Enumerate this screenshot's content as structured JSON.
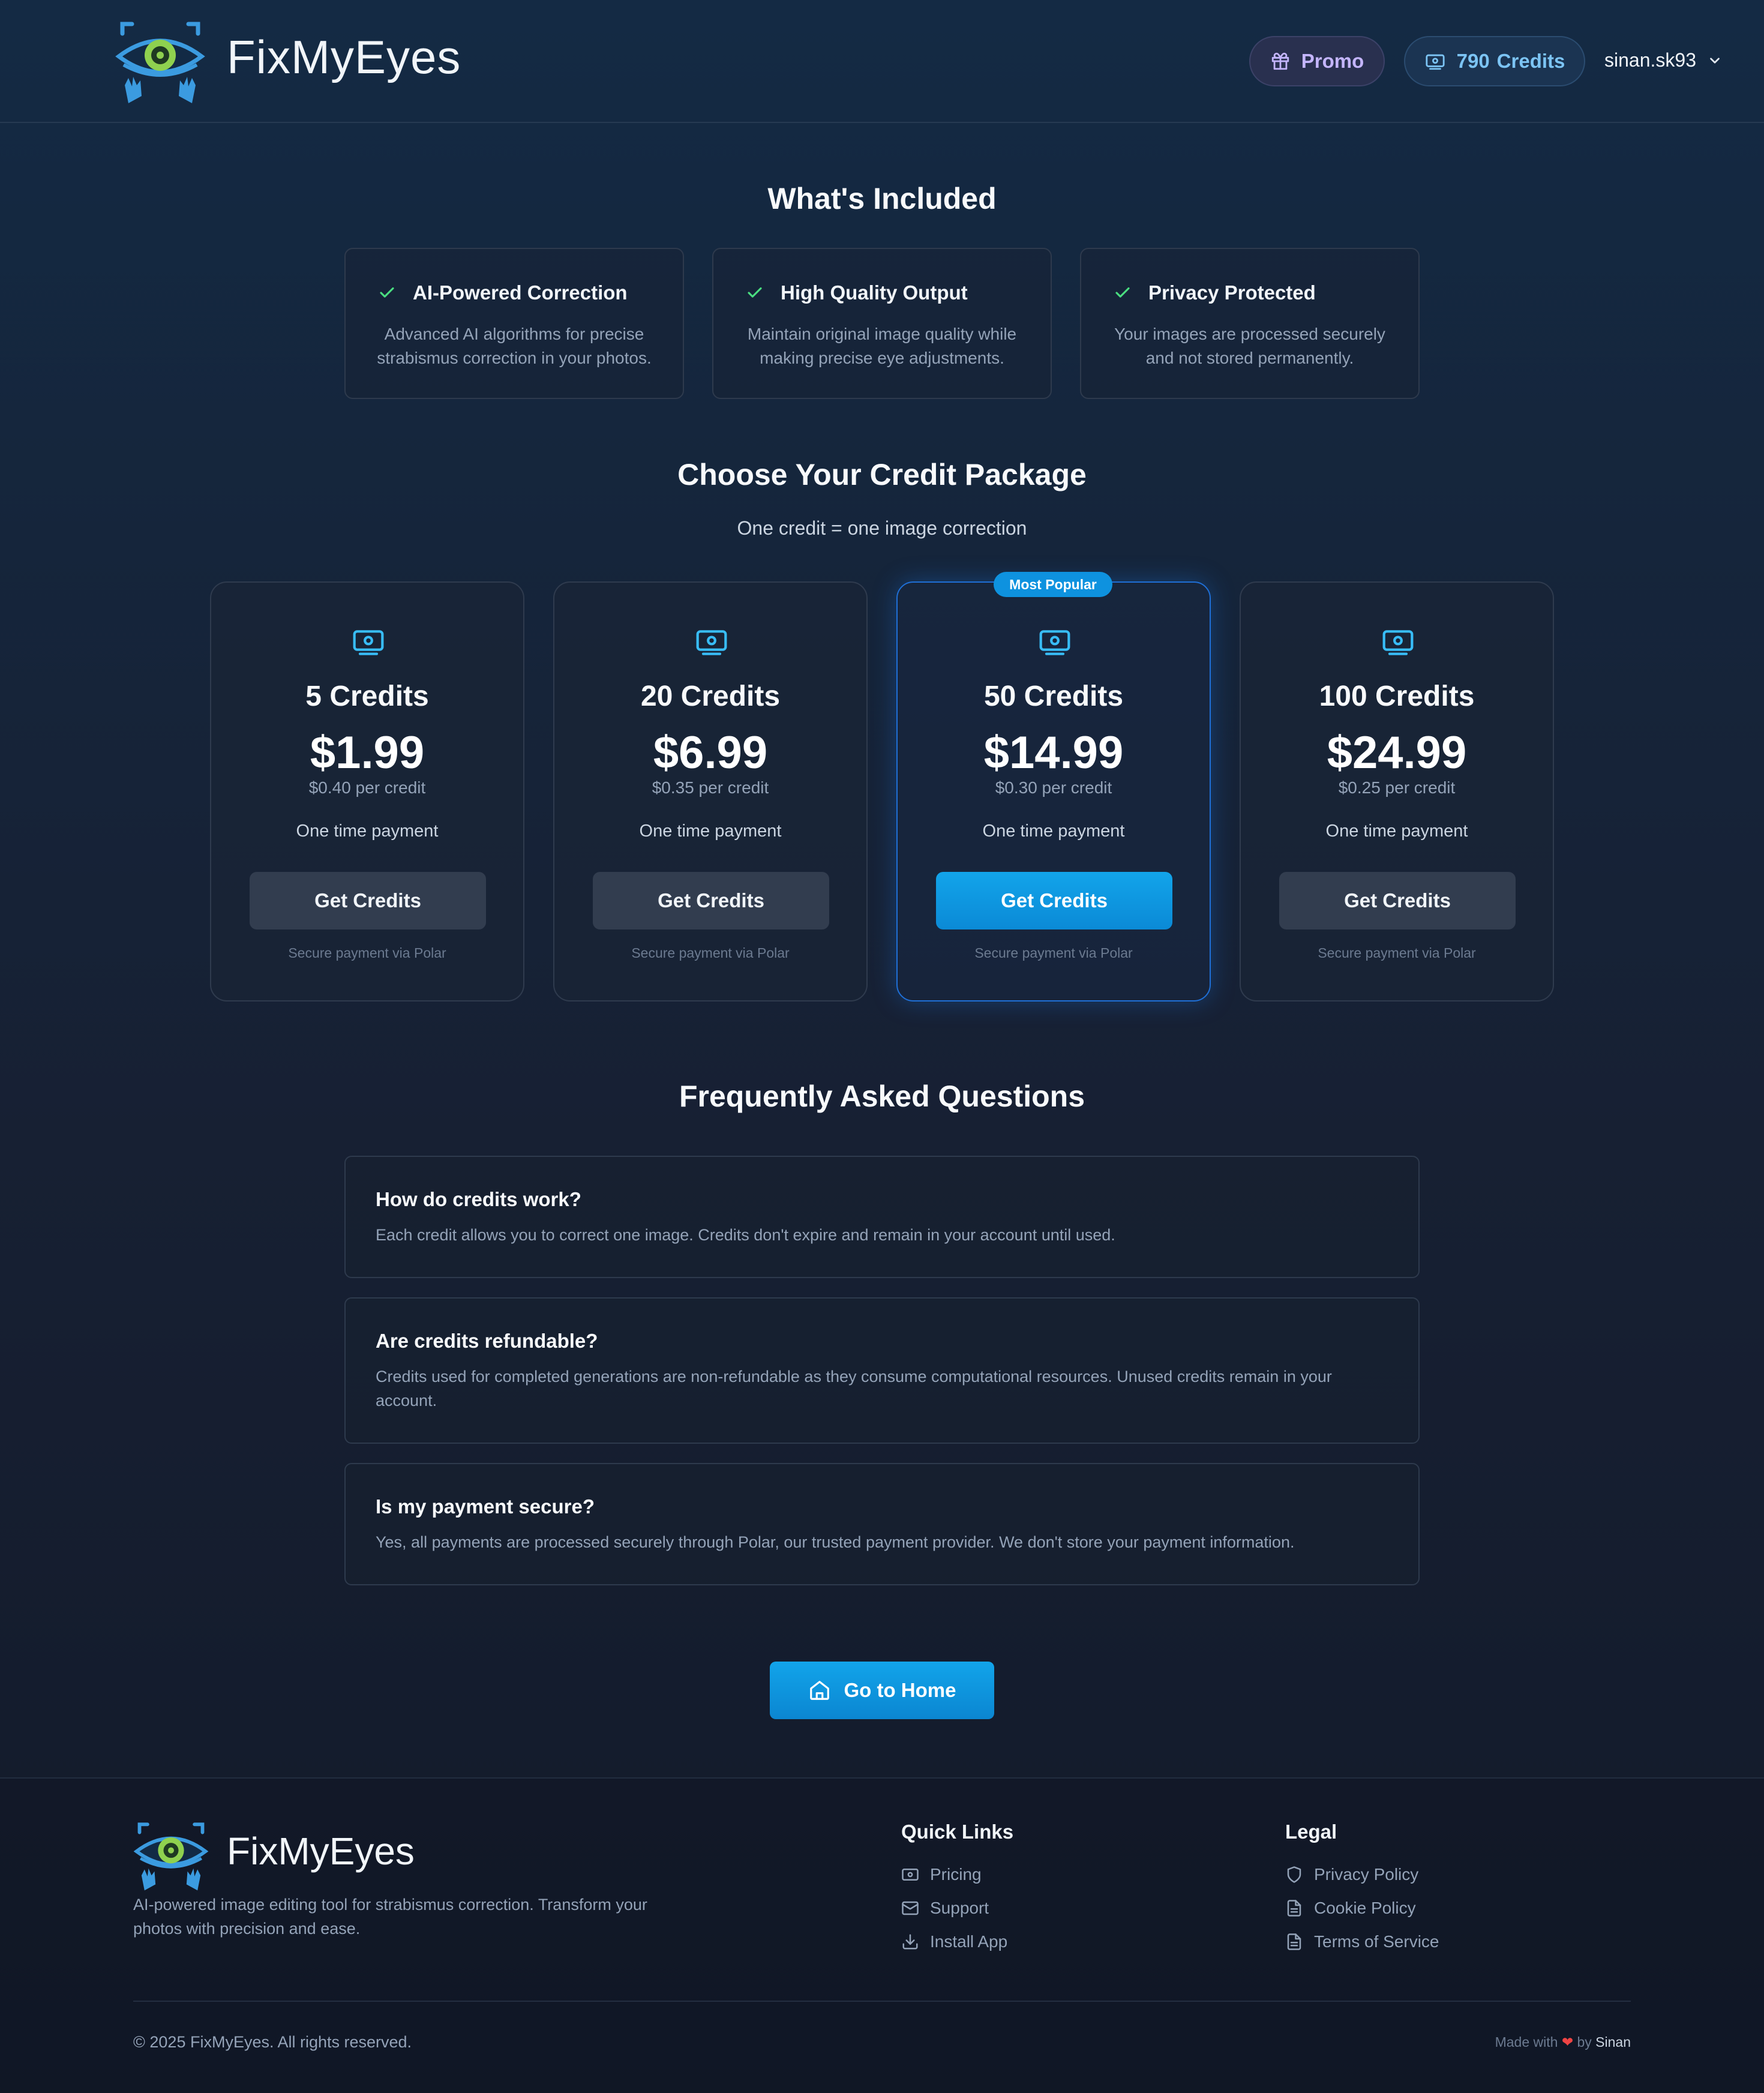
{
  "header": {
    "brand": "FixMyEyes",
    "promo_label": "Promo",
    "credits_count": "790",
    "credits_label": "Credits",
    "username": "sinan.sk93"
  },
  "included": {
    "title": "What's Included",
    "features": [
      {
        "title": "AI-Powered Correction",
        "desc": "Advanced AI algorithms for precise strabismus correction in your photos."
      },
      {
        "title": "High Quality Output",
        "desc": "Maintain original image quality while making precise eye adjustments."
      },
      {
        "title": "Privacy Protected",
        "desc": "Your images are processed securely and not stored permanently."
      }
    ]
  },
  "packages": {
    "title": "Choose Your Credit Package",
    "subtitle": "One credit = one image correction",
    "popular_badge": "Most Popular",
    "items": [
      {
        "name": "5 Credits",
        "price": "$1.99",
        "per_credit": "$0.40 per credit",
        "payment": "One time payment",
        "button": "Get Credits",
        "secure": "Secure payment via Polar"
      },
      {
        "name": "20 Credits",
        "price": "$6.99",
        "per_credit": "$0.35 per credit",
        "payment": "One time payment",
        "button": "Get Credits",
        "secure": "Secure payment via Polar"
      },
      {
        "name": "50 Credits",
        "price": "$14.99",
        "per_credit": "$0.30 per credit",
        "payment": "One time payment",
        "button": "Get Credits",
        "secure": "Secure payment via Polar"
      },
      {
        "name": "100 Credits",
        "price": "$24.99",
        "per_credit": "$0.25 per credit",
        "payment": "One time payment",
        "button": "Get Credits",
        "secure": "Secure payment via Polar"
      }
    ]
  },
  "faq": {
    "title": "Frequently Asked Questions",
    "items": [
      {
        "q": "How do credits work?",
        "a": "Each credit allows you to correct one image. Credits don't expire and remain in your account until used."
      },
      {
        "q": "Are credits refundable?",
        "a": "Credits used for completed generations are non-refundable as they consume computational resources. Unused credits remain in your account."
      },
      {
        "q": "Is my payment secure?",
        "a": "Yes, all payments are processed securely through Polar, our trusted payment provider. We don't store your payment information."
      }
    ]
  },
  "home_button": "Go to Home",
  "footer": {
    "brand": "FixMyEyes",
    "description": "AI-powered image editing tool for strabismus correction. Transform your photos with precision and ease.",
    "quick_links_title": "Quick Links",
    "quick_links": [
      "Pricing",
      "Support",
      "Install App"
    ],
    "legal_title": "Legal",
    "legal_links": [
      "Privacy Policy",
      "Cookie Policy",
      "Terms of Service"
    ],
    "copyright": "© 2025 FixMyEyes. All rights reserved.",
    "made_with": "Made with",
    "made_by": "by",
    "author": "Sinan"
  },
  "colors": {
    "accent": "#0e92df",
    "check": "#4ade80",
    "promo": "#c4b5fd",
    "credits": "#7cc4f4"
  },
  "icons": {
    "promo": "gift-icon",
    "credits": "banknote-icon",
    "user_menu": "chevron-down-icon",
    "feature": "check-icon",
    "home": "home-icon"
  }
}
